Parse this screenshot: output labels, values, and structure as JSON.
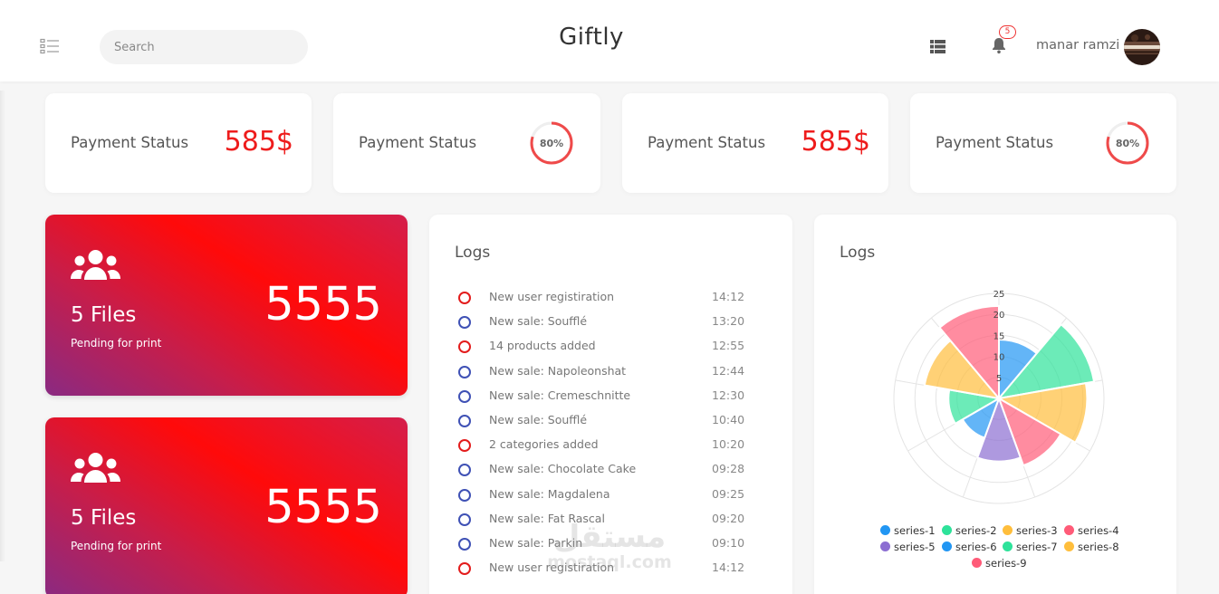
{
  "header": {
    "search_placeholder": "Search",
    "brand": "Giftly",
    "notifications_count": "5",
    "user_name": "manar ramzi"
  },
  "stats": [
    {
      "label": "Payment Status",
      "type": "value",
      "value": "585$"
    },
    {
      "label": "Payment Status",
      "type": "ring",
      "value": "80%",
      "progress": 0.8
    },
    {
      "label": "Payment Status",
      "type": "value",
      "value": "585$"
    },
    {
      "label": "Payment Status",
      "type": "ring",
      "value": "80%",
      "progress": 0.8
    }
  ],
  "promos": [
    {
      "title": "5 Files",
      "subtitle": "Pending for print",
      "number": "5555"
    },
    {
      "title": "5 Files",
      "subtitle": "Pending for print",
      "number": "5555"
    }
  ],
  "logs": {
    "title": "Logs",
    "items": [
      {
        "text": "New user registiration",
        "time": "14:12",
        "status": "red"
      },
      {
        "text": "New sale: Soufflé",
        "time": "13:20",
        "status": "blue"
      },
      {
        "text": "14 products added",
        "time": "12:55",
        "status": "red"
      },
      {
        "text": "New sale: Napoleonshat",
        "time": "12:44",
        "status": "blue"
      },
      {
        "text": "New sale: Cremeschnitte",
        "time": "12:30",
        "status": "blue"
      },
      {
        "text": "New sale: Soufflé",
        "time": "10:40",
        "status": "blue"
      },
      {
        "text": "2 categories added",
        "time": "10:20",
        "status": "red"
      },
      {
        "text": "New sale: Chocolate Cake",
        "time": "09:28",
        "status": "blue"
      },
      {
        "text": "New sale: Magdalena",
        "time": "09:25",
        "status": "blue"
      },
      {
        "text": "New sale: Fat Rascal",
        "time": "09:20",
        "status": "blue"
      },
      {
        "text": "New sale: Parkin",
        "time": "09:10",
        "status": "blue"
      },
      {
        "text": "New user registiration",
        "time": "14:12",
        "status": "red"
      }
    ]
  },
  "polar_card": {
    "title": "Logs"
  },
  "chart_data": {
    "type": "polarArea",
    "r_ticks": [
      "25",
      "20",
      "15",
      "10",
      "5"
    ],
    "rmax": 25,
    "series": [
      {
        "name": "series-1",
        "value": 14,
        "color": "#2196f3"
      },
      {
        "name": "series-2",
        "value": 23,
        "color": "#2ee29a"
      },
      {
        "name": "series-3",
        "value": 21,
        "color": "#ffbe3c"
      },
      {
        "name": "series-4",
        "value": 17,
        "color": "#ff5b78"
      },
      {
        "name": "series-5",
        "value": 15,
        "color": "#8c6ed2"
      },
      {
        "name": "series-6",
        "value": 10,
        "color": "#2196f3"
      },
      {
        "name": "series-7",
        "value": 12,
        "color": "#2ee29a"
      },
      {
        "name": "series-8",
        "value": 18,
        "color": "#ffbe3c"
      },
      {
        "name": "series-9",
        "value": 22,
        "color": "#ff5b78"
      }
    ],
    "legend_position": "bottom"
  },
  "watermark": {
    "arabic": "مستقل",
    "latin": "mostaql.com"
  }
}
